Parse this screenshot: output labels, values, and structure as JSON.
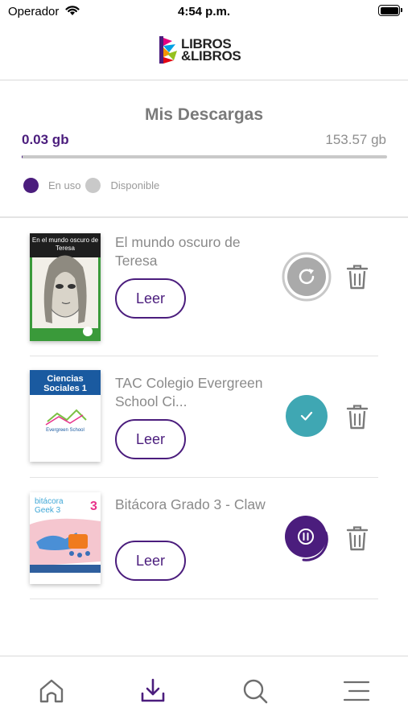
{
  "status_bar": {
    "carrier": "Operador",
    "time": "4:54 p.m."
  },
  "header": {
    "logo_line1": "LIBROS",
    "logo_line2": "&LIBROS"
  },
  "downloads": {
    "title": "Mis Descargas",
    "used": "0.03 gb",
    "total": "153.57 gb",
    "used_fraction": 0.0002,
    "legend": [
      {
        "label": "En uso",
        "color": "#4b1d7d"
      },
      {
        "label": "Disponible",
        "color": "#c9c9c9"
      }
    ]
  },
  "books": [
    {
      "title": "El mundo oscuro de Teresa",
      "read_label": "Leer",
      "cover_text": "En el mundo oscuro de Teresa",
      "status": "retry-icon"
    },
    {
      "title": "TAC Colegio Evergreen School Ci...",
      "read_label": "Leer",
      "cover_text": "Ciencias Sociales 1",
      "status": "check-icon"
    },
    {
      "title": "Bitácora Grado 3 - Claw",
      "read_label": "Leer",
      "cover_text": "bitácora Geek 3",
      "status": "pause-icon"
    }
  ],
  "colors": {
    "brand_purple": "#4b1d7d",
    "teal": "#3fa7b3"
  },
  "tab_bar": [
    "home-icon",
    "download-icon",
    "search-icon",
    "menu-icon"
  ]
}
